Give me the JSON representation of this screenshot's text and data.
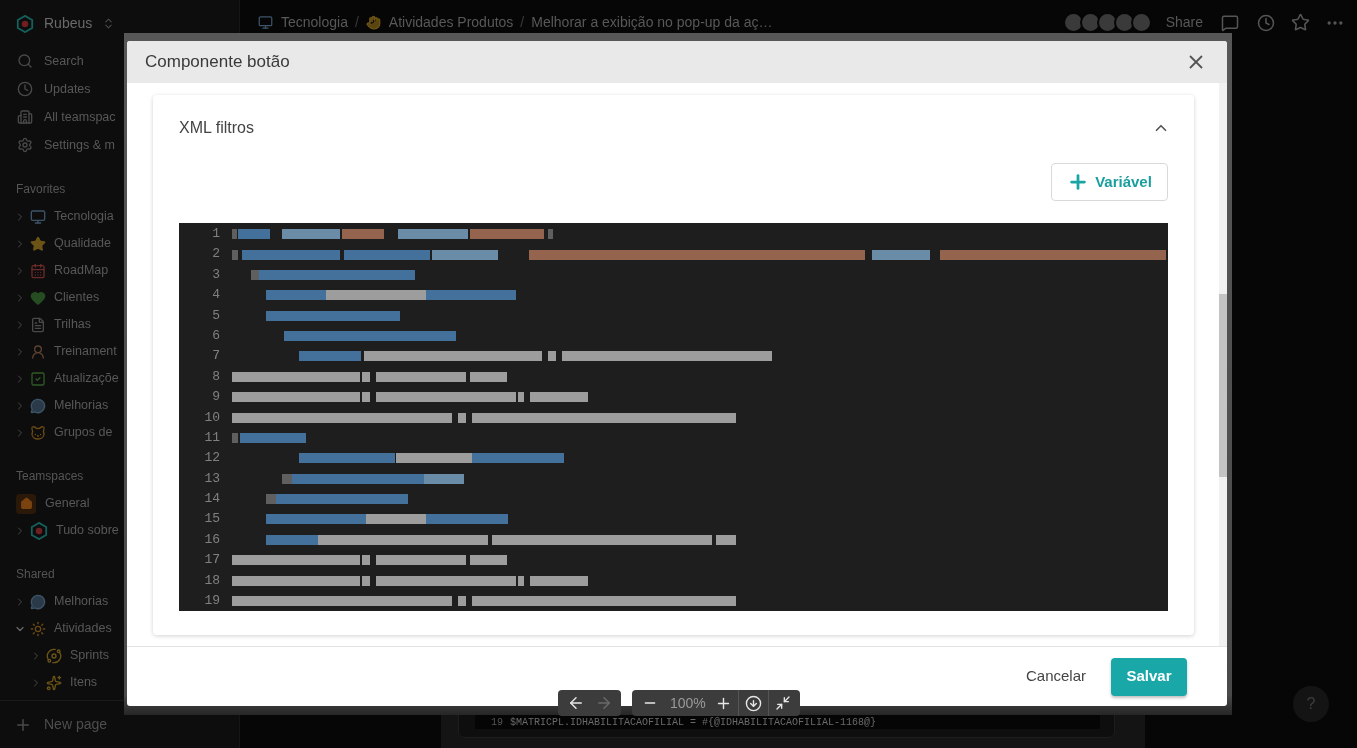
{
  "sidebar": {
    "workspace": "Rubeus",
    "nav": [
      {
        "label": "Search"
      },
      {
        "label": "Updates"
      },
      {
        "label": "All teamspac"
      },
      {
        "label": "Settings & m"
      }
    ],
    "sections": [
      {
        "title": "Favorites",
        "items": [
          {
            "label": "Tecnologia",
            "expanded": false
          },
          {
            "label": "Qualidade",
            "expanded": false
          },
          {
            "label": "RoadMap",
            "expanded": false
          },
          {
            "label": "Clientes",
            "expanded": false
          },
          {
            "label": "Trilhas",
            "expanded": false
          },
          {
            "label": "Treinament",
            "expanded": false
          },
          {
            "label": "Atualizaçõe",
            "expanded": false
          },
          {
            "label": "Melhorias",
            "expanded": false
          },
          {
            "label": "Grupos de",
            "expanded": false
          }
        ]
      },
      {
        "title": "Teamspaces",
        "items": [
          {
            "label": "General"
          },
          {
            "label": "Tudo sobre",
            "expanded": false
          }
        ]
      },
      {
        "title": "Shared",
        "items": [
          {
            "label": "Melhorias",
            "expanded": false
          },
          {
            "label": "Atividades",
            "expanded": true,
            "children": [
              {
                "label": "Sprints",
                "expanded": false
              },
              {
                "label": "Itens",
                "expanded": false
              }
            ]
          }
        ]
      }
    ],
    "new_page": "New page"
  },
  "topbar": {
    "breadcrumbs": [
      {
        "kind": "page",
        "label": "Tecnologia"
      },
      {
        "kind": "separator",
        "label": "/"
      },
      {
        "kind": "page",
        "label": "Atividades Produtos"
      },
      {
        "kind": "separator",
        "label": "/"
      },
      {
        "kind": "page",
        "label": "Melhorar a exibição no pop-up da aç…"
      }
    ],
    "share": "Share"
  },
  "page": {
    "code_line_number": "19",
    "code_line": "$MATRICPL.IDHABILITACAOFILIAL = #{@IDHABILITACAOFILIAL-1168@}"
  },
  "lightbox": {
    "modal": {
      "title": "Componente botão",
      "section": {
        "title": "XML filtros",
        "expanded": true
      },
      "add_button": "Variável",
      "editor": {
        "line_numbers": [
          "1",
          "2",
          "3",
          "4",
          "5",
          "6",
          "7",
          "8",
          "9",
          "10",
          "11",
          "12",
          "13",
          "14",
          "15",
          "16",
          "17",
          "18",
          "19"
        ]
      },
      "cancel_button": "Cancelar",
      "save_button": "Salvar"
    },
    "toolbar": {
      "previous": {
        "disabled": false
      },
      "next": {
        "disabled": true
      },
      "zoom": "100%"
    }
  },
  "help_button": "?"
}
